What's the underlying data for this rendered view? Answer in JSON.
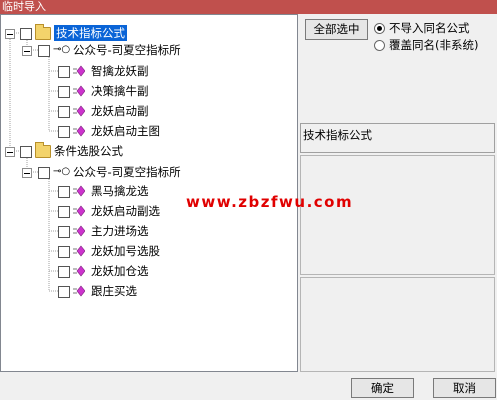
{
  "window": {
    "title": "临时导入"
  },
  "tree": {
    "groups": [
      {
        "label": "技术指标公式",
        "selected": true,
        "sub": {
          "label": "公众号-司夏空指标所",
          "items": [
            "智擒龙妖副",
            "决策擒牛副",
            "龙妖启动副",
            "龙妖启动主图"
          ]
        }
      },
      {
        "label": "条件选股公式",
        "selected": false,
        "sub": {
          "label": "公众号-司夏空指标所",
          "items": [
            "黑马擒龙选",
            "龙妖启动副选",
            "主力进场选",
            "龙妖加号选股",
            "龙妖加仓选",
            "跟庄买选"
          ]
        }
      }
    ]
  },
  "right": {
    "select_all_button": "全部选中",
    "radio_no_import": "不导入同名公式",
    "radio_overwrite": "覆盖同名(非系统)",
    "selected_type_label": "技术指标公式"
  },
  "watermark": "www.zbzfwu.com",
  "buttons": {
    "ok": "确定",
    "cancel": "取消"
  },
  "colors": {
    "title_bar": "#c0504d",
    "selection": "#0a64d7",
    "watermark": "#e00000",
    "leaf_icon": "#cc33cc"
  }
}
